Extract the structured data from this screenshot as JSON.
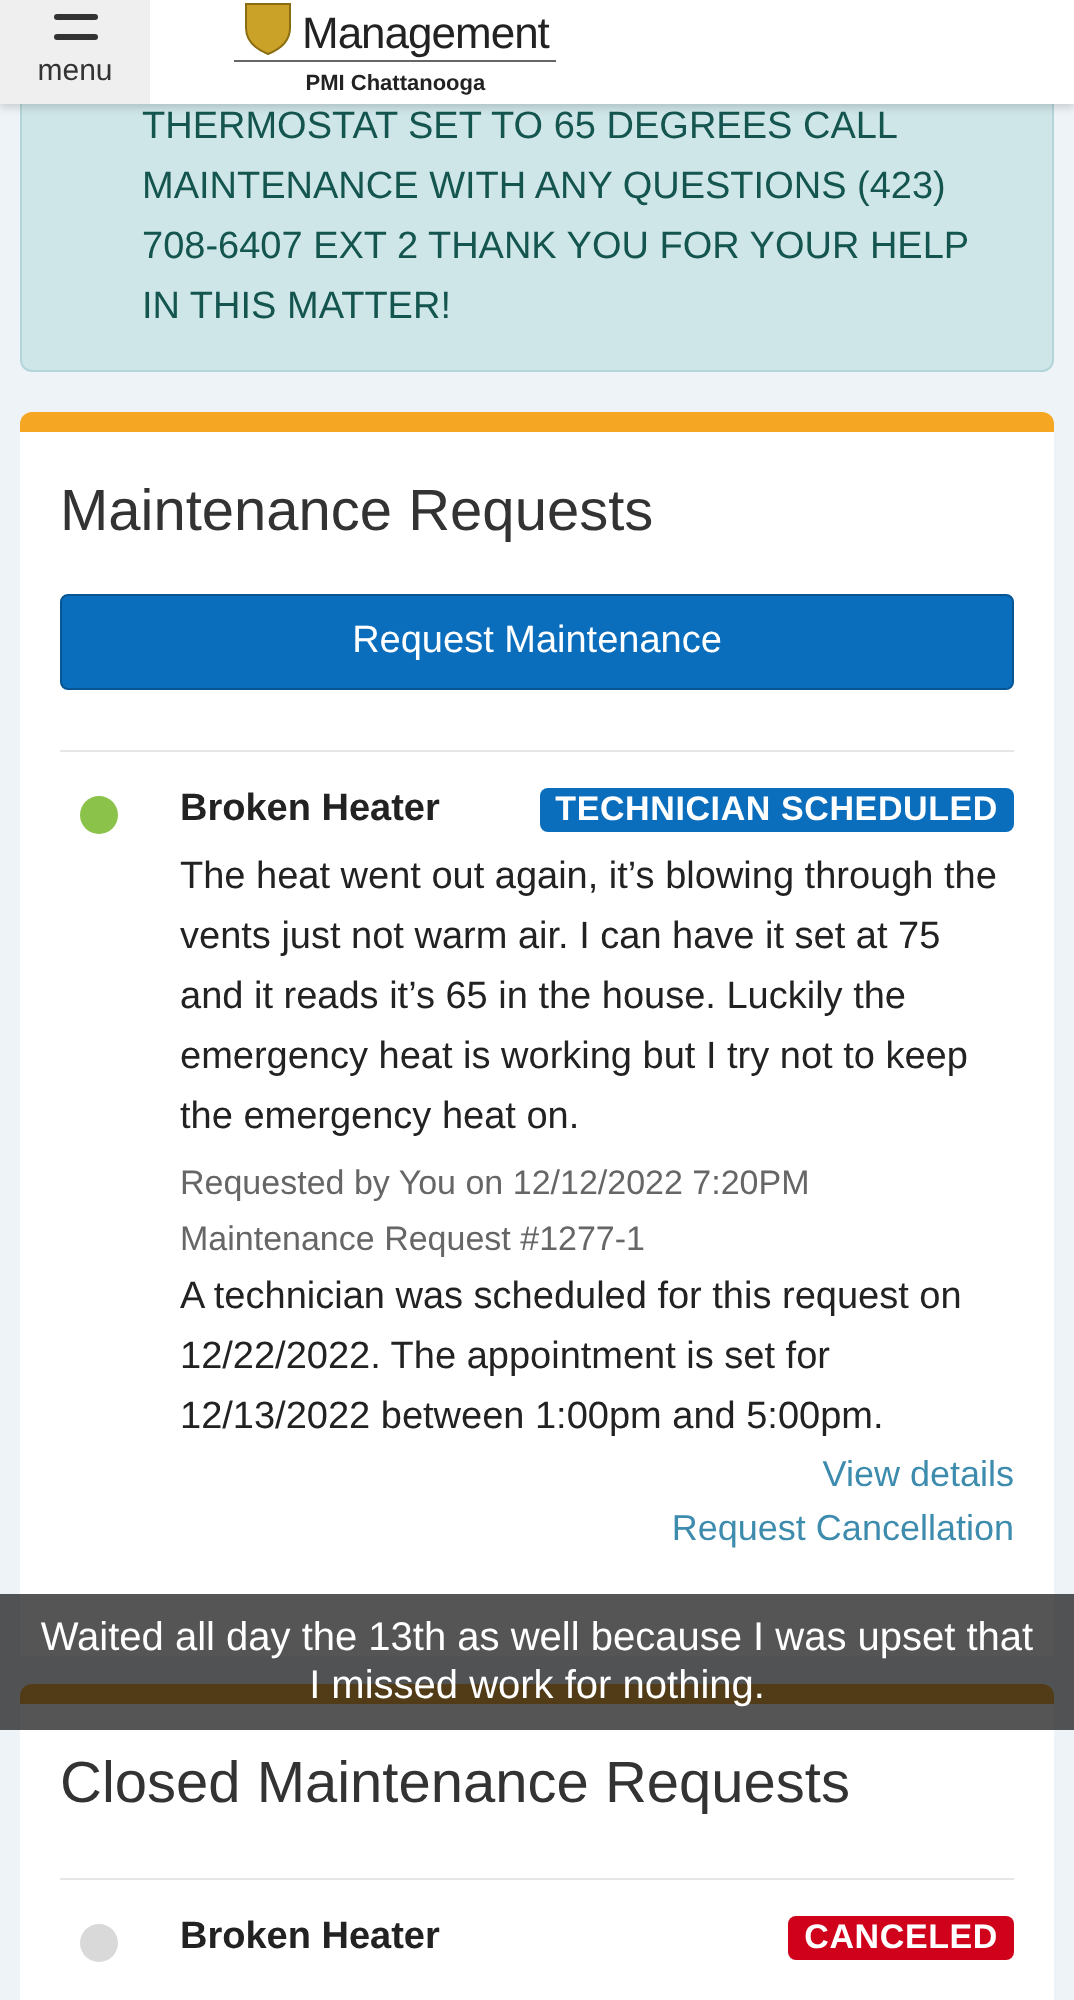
{
  "header": {
    "menu_label": "menu",
    "logo_text": "Management",
    "location": "PMI Chattanooga"
  },
  "notice": "THERMOSTAT SET TO 65 DEGREES CALL MAINTENANCE WITH ANY QUESTIONS (423) 708-6407 EXT 2 THANK YOU FOR YOUR HELP IN THIS MATTER!",
  "open_requests": {
    "title": "Maintenance Requests",
    "button": "Request Maintenance",
    "items": [
      {
        "title": "Broken Heater",
        "status": {
          "label": "TECHNICIAN SCHEDULED",
          "color": "#0a6ebd"
        },
        "color": "#8bc34a",
        "description": "The heat went out again, it’s blowing through the vents just not warm air. I can have it set at 75 and it reads it’s 65 in the house. Luckily the emergency heat is working but I try not to keep the emergency heat on.",
        "requested": "Requested by You on 12/12/2022 7:20PM",
        "number": "Maintenance Request #1277-1",
        "note": "A technician was scheduled for this request on 12/22/2022. The appointment is set for 12/13/2022 between 1:00pm and 5:00pm.",
        "links": [
          "View details",
          "Request Cancellation"
        ]
      }
    ]
  },
  "closed_requests": {
    "title": "Closed Maintenance Requests",
    "items": [
      {
        "title": "Broken Heater",
        "status": {
          "label": "CANCELED",
          "color": "#d0021b"
        },
        "color": "#d9d9d9"
      }
    ]
  },
  "caption": "Waited all day the 13th as well because I was upset that I missed work for nothing."
}
